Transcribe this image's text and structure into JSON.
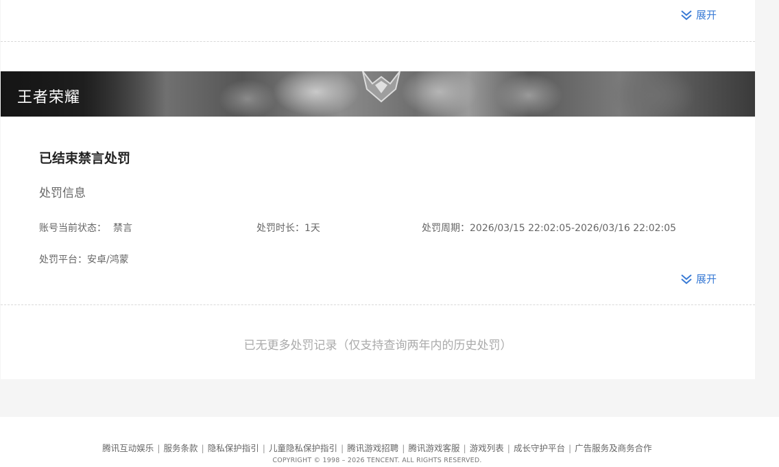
{
  "expand_label": "展开",
  "game": {
    "name": "王者荣耀"
  },
  "record": {
    "title": "已结束禁言处罚",
    "info_heading": "处罚信息",
    "status_label": "账号当前状态：",
    "status_value": "禁言",
    "duration_label": "处罚时长：",
    "duration_value": "1天",
    "period_label": "处罚周期：",
    "period_value": "2026/03/15 22:02:05-2026/03/16 22:02:05",
    "platform_label": "处罚平台：",
    "platform_value": "安卓/鸿蒙"
  },
  "no_more_text": "已无更多处罚记录（仅支持查询两年内的历史处罚）",
  "footer": {
    "links": [
      "腾讯互动娱乐",
      "服务条款",
      "隐私保护指引",
      "儿童隐私保护指引",
      "腾讯游戏招聘",
      "腾讯游戏客服",
      "游戏列表",
      "成长守护平台",
      "广告服务及商务合作"
    ],
    "separator": "|",
    "copyright": "COPYRIGHT © 1998 – 2026 TENCENT. ALL RIGHTS RESERVED."
  },
  "colors": {
    "accent": "#3a7bd5",
    "muted_text": "#aaaaaa"
  }
}
